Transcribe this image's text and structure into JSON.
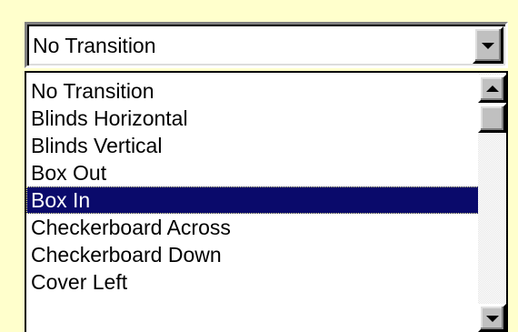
{
  "combo": {
    "selected_value": "No Transition",
    "button_icon": "chevron-down-icon"
  },
  "dropdown": {
    "items": [
      {
        "label": "No Transition"
      },
      {
        "label": "Blinds Horizontal"
      },
      {
        "label": "Blinds Vertical"
      },
      {
        "label": "Box Out"
      },
      {
        "label": "Box In"
      },
      {
        "label": "Checkerboard Across"
      },
      {
        "label": "Checkerboard Down"
      },
      {
        "label": "Cover Left"
      }
    ],
    "highlighted_item": "Box In"
  },
  "scrollbar": {
    "up_icon": "arrow-up-icon",
    "down_icon": "arrow-down-icon",
    "scroll_position": 0
  },
  "colors": {
    "background": "#FFFFCC",
    "selection": "#0A0A6B",
    "chrome": "#C0C0C0"
  }
}
